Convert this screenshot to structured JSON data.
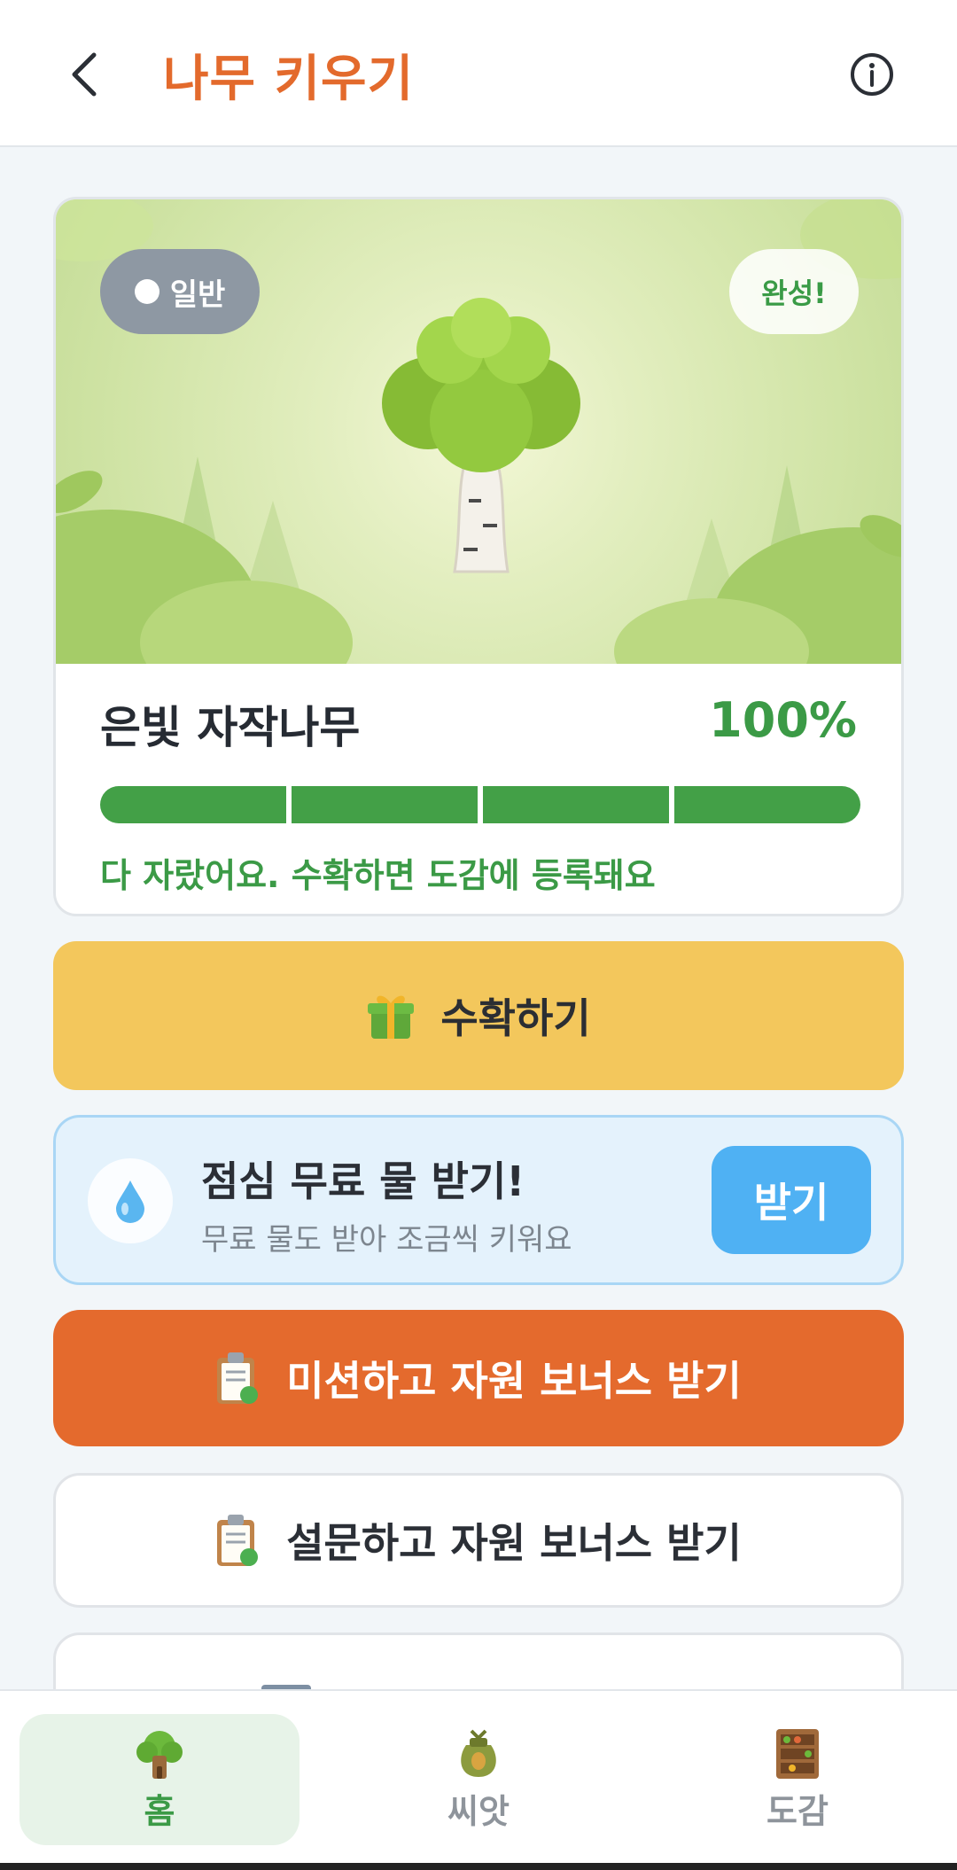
{
  "header": {
    "title": "나무 키우기",
    "back_icon": "chevron-left-icon",
    "info_icon": "info-circle-icon"
  },
  "tree_card": {
    "rarity_label": "일반",
    "complete_label": "완성!",
    "tree_name": "은빛 자작나무",
    "growth_percent": "100%",
    "growth_value": 100,
    "progress_segments": 4,
    "message": "다 자랐어요. 수확하면 도감에 등록돼요"
  },
  "harvest": {
    "label": "수확하기",
    "icon": "gift-icon"
  },
  "water": {
    "title": "점심 무료 물 받기!",
    "subtitle": "무료 물도 받아 조금씩 키워요",
    "button": "받기",
    "icon": "water-drop-icon"
  },
  "mission": {
    "label": "미션하고 자원 보너스 받기",
    "icon": "clipboard-icon"
  },
  "survey": {
    "label": "설문하고 자원 보너스 받기",
    "icon": "clipboard-icon"
  },
  "tabs": [
    {
      "label": "홈",
      "icon": "tree-house-icon",
      "active": true
    },
    {
      "label": "씨앗",
      "icon": "seed-bag-icon",
      "active": false
    },
    {
      "label": "도감",
      "icon": "bookshelf-icon",
      "active": false
    }
  ],
  "colors": {
    "accent_orange": "#e36a2c",
    "growth_green": "#43a047",
    "harvest_yellow": "#f3c75c",
    "water_blue": "#4fb1f3"
  }
}
